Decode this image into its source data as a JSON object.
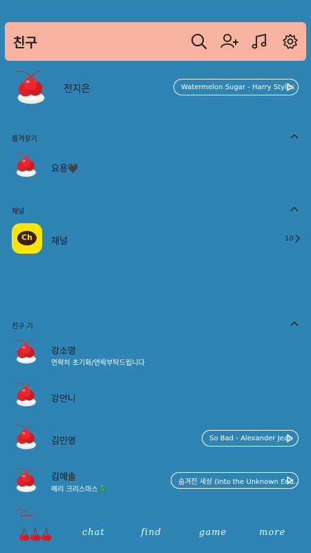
{
  "header": {
    "title": "친구",
    "icons": [
      "search-icon",
      "add-friend-icon",
      "music-icon",
      "settings-icon"
    ]
  },
  "profile": {
    "name": "전지은",
    "music": "Watermelon Sugar - Harry Styles"
  },
  "favorites": {
    "label": "즐겨찾기",
    "items": [
      {
        "name": "요용🖤"
      }
    ]
  },
  "channel": {
    "label": "채널",
    "name": "채널",
    "badge": "Ch",
    "count": "10"
  },
  "friends": {
    "label": "친구 기",
    "items": [
      {
        "name": "강소영",
        "status": "연락처 초기화/연락부탁드립니다"
      },
      {
        "name": "강언니"
      },
      {
        "name": "김민영",
        "music": "So Bad - Alexander Jean"
      },
      {
        "name": "김예솔",
        "status": "메리 크리스마스🎄",
        "music": "숨겨진 세상 (Into the Unknown End..."
      }
    ]
  },
  "tabs": [
    "chat",
    "find",
    "game",
    "more"
  ],
  "colors": {
    "background": "#2e84b4",
    "header": "#f8b3a1",
    "channel_badge": "#fde500"
  }
}
